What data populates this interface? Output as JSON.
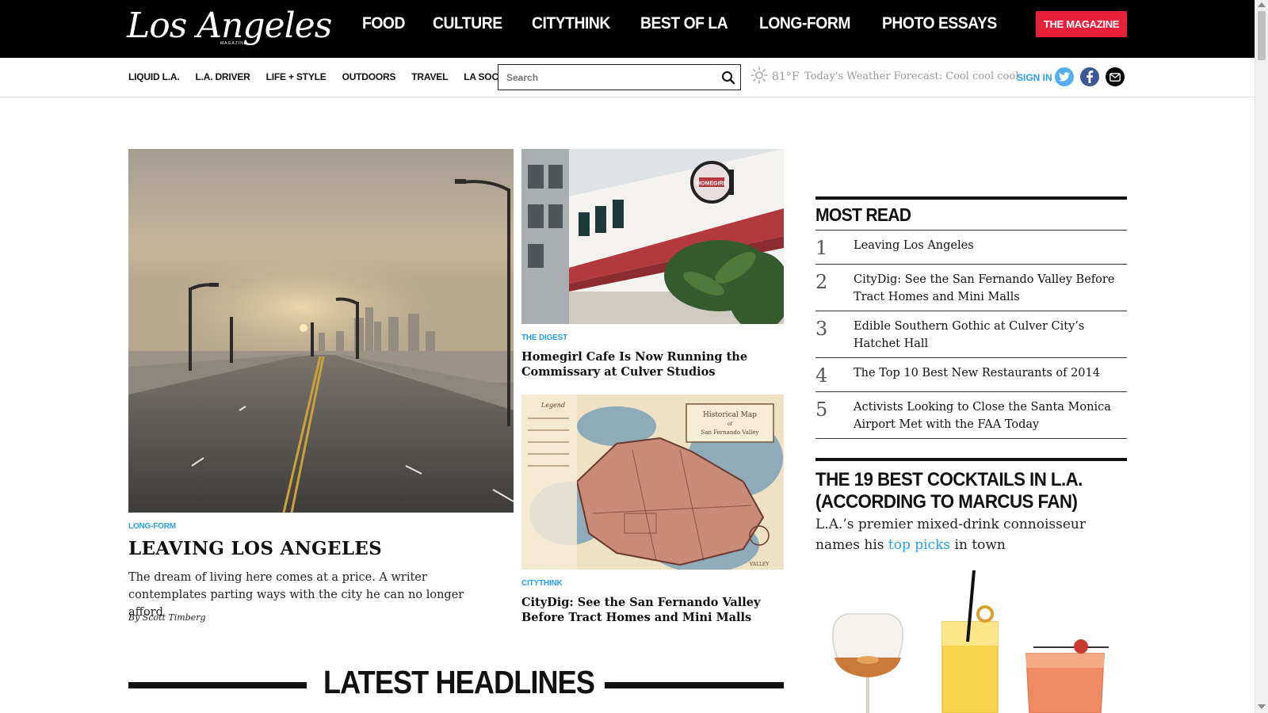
{
  "brand": {
    "logo_text": "Los Angeles",
    "logo_subtext": "MAGAZINE"
  },
  "main_nav": [
    "FOOD",
    "CULTURE",
    "CITYTHINK",
    "BEST OF LA",
    "LONG-FORM",
    "PHOTO ESSAYS"
  ],
  "magazine_button": "THE MAGAZINE",
  "sub_nav": [
    "LIQUID L.A.",
    "L.A. DRIVER",
    "LIFE + STYLE",
    "OUTDOORS",
    "TRAVEL",
    "LA SOCIAL"
  ],
  "search": {
    "placeholder": "Search",
    "value": ""
  },
  "weather": {
    "icon": "sun-icon",
    "temperature": "81°F",
    "forecast": "Today's Weather Forecast: Cool cool cool"
  },
  "account": {
    "sign_in": "SIGN IN"
  },
  "social": [
    {
      "icon": "twitter-icon",
      "color": "#55acee"
    },
    {
      "icon": "facebook-icon",
      "color": "#3b5998"
    },
    {
      "icon": "email-icon",
      "color": "#000000"
    }
  ],
  "hero": {
    "category": "LONG-FORM",
    "title": "LEAVING LOS ANGELES",
    "dek": "The dream of living here comes at a price. A writer contemplates parting ways with the city he can no longer afford",
    "byline": "By Scott Timberg"
  },
  "cards": [
    {
      "category": "THE DIGEST",
      "title": "Homegirl Cafe Is Now Running the Commissary at Culver Studios",
      "sign_text": "HOMEGIRL"
    },
    {
      "category": "CITYTHINK",
      "title": "CityDig: See the San Fernando Valley Before Tract Homes and Mini Malls",
      "map_title": "Historical Map of San Fernando Valley",
      "map_legend": "Legend",
      "map_footer": "VALLEY"
    }
  ],
  "latest_headlines": "LATEST HEADLINES",
  "most_read": {
    "title": "MOST READ",
    "items": [
      {
        "rank": "1",
        "title": "Leaving Los Angeles"
      },
      {
        "rank": "2",
        "title": "CityDig: See the San Fernando Valley Before Tract Homes and Mini Malls"
      },
      {
        "rank": "3",
        "title": "Edible Southern Gothic at Culver City’s Hatchet Hall"
      },
      {
        "rank": "4",
        "title": "The Top 10 Best New Restaurants of 2014"
      },
      {
        "rank": "5",
        "title": "Activists Looking to Close the Santa Monica Airport Met with the FAA Today"
      }
    ]
  },
  "promo": {
    "title_line1": "THE 19 BEST COCKTAILS IN L.A.",
    "title_line2": "(ACCORDING TO MARCUS FAN)",
    "dek_before": "L.A.’s premier mixed-drink connoisseur names his ",
    "dek_link": "top picks",
    "dek_after": " in town"
  },
  "colors": {
    "accent_blue": "#2a9df4",
    "magazine_red": "#e8203a",
    "topbar_black": "#000000"
  }
}
